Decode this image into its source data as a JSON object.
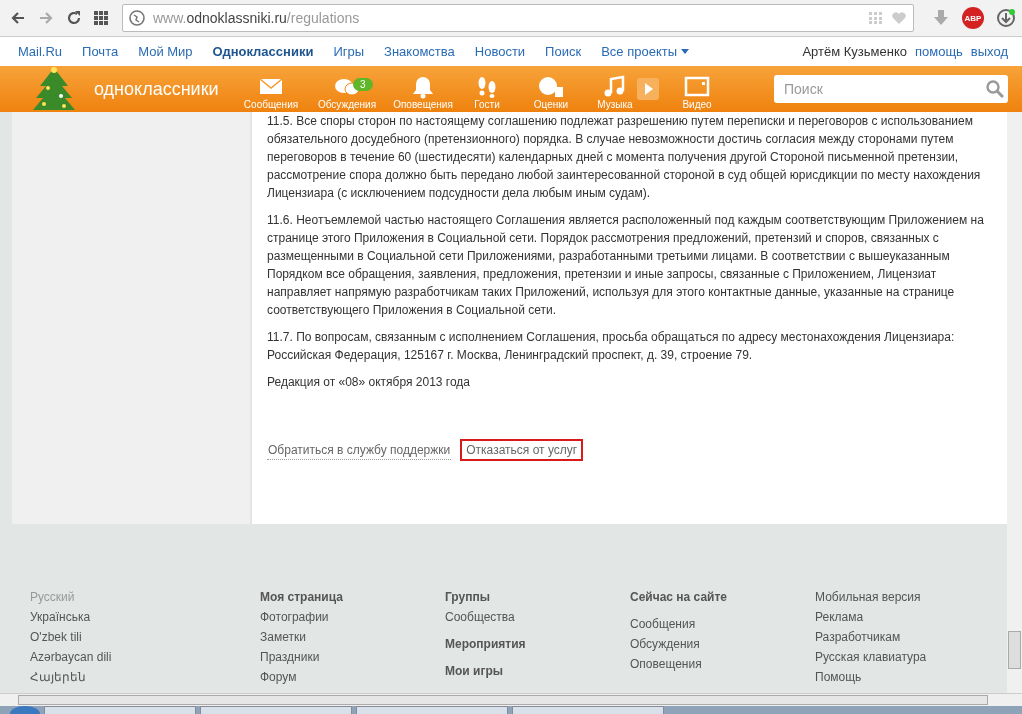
{
  "browser": {
    "url_host_prefix": "www.",
    "url_host": "odnoklassniki.ru",
    "url_path": "/regulations",
    "addon_label": "ABP"
  },
  "portal_bar": {
    "links": [
      {
        "label": "Mail.Ru",
        "selected": false
      },
      {
        "label": "Почта",
        "selected": false
      },
      {
        "label": "Мой Мир",
        "selected": false
      },
      {
        "label": "Одноклассники",
        "selected": true
      },
      {
        "label": "Игры",
        "selected": false
      },
      {
        "label": "Знакомства",
        "selected": false
      },
      {
        "label": "Новости",
        "selected": false
      },
      {
        "label": "Поиск",
        "selected": false
      },
      {
        "label": "Все проекты",
        "selected": false,
        "dropdown": true
      }
    ],
    "user": "Артём Кузьменко",
    "help": "помощь",
    "logout": "выход"
  },
  "header": {
    "logo": "одноклассники",
    "nav": [
      {
        "label": "Сообщения",
        "kind": "envelope"
      },
      {
        "label": "Обсуждения",
        "kind": "chat",
        "badge": "3"
      },
      {
        "label": "Оповещения",
        "kind": "bell"
      },
      {
        "label": "Гости",
        "kind": "feet"
      },
      {
        "label": "Оценки",
        "kind": "rating"
      },
      {
        "label": "Музыка",
        "kind": "note"
      },
      {
        "label": "Видео",
        "kind": "video"
      }
    ],
    "search": {
      "placeholder": "Поиск"
    }
  },
  "content": {
    "paragraphs": [
      "11.5. Все споры сторон по настоящему соглашению подлежат разрешению путем переписки и переговоров с использованием обязательного досудебного (претензионного) порядка. В случае невозможности достичь согласия между сторонами путем переговоров в течение 60 (шестидесяти) календарных дней с момента получения другой Стороной письменной претензии, рассмотрение спора должно быть передано любой заинтересованной стороной в суд общей юрисдикции по месту нахождения Лицензиара (с исключением подсудности дела любым иным судам).",
      "11.6. Неотъемлемой частью настоящего Соглашения является расположенный под каждым соответствующим Приложением на странице этого Приложения в Социальной сети. Порядок рассмотрения предложений, претензий и споров, связанных с размещенными в Социальной сети Приложениями, разработанными третьими лицами. В соответствии с вышеуказанным Порядком все обращения, заявления, предложения, претензии и иные запросы, связанные с Приложением, Лицензиат направляет напрямую разработчикам таких Приложений, используя для этого контактные данные, указанные на странице соответствующего Приложения в Социальной сети.",
      "11.7. По вопросам, связанным с исполнением Соглашения, просьба обращаться по адресу местонахождения Лицензиара: Российская Федерация, 125167 г. Москва, Ленинградский проспект, д. 39, строение 79.",
      "Редакция от «08» октября 2013 года"
    ],
    "links": [
      {
        "label": "Обратиться в службу поддержки",
        "highlighted": false
      },
      {
        "label": "Отказаться от услуг",
        "highlighted": true
      }
    ]
  },
  "footer": {
    "columns": [
      [
        {
          "label": "Русский",
          "kind": "current"
        },
        {
          "label": "Українська",
          "kind": "link"
        },
        {
          "label": "O'zbek tili",
          "kind": "link"
        },
        {
          "label": "Azərbaycan dili",
          "kind": "link"
        },
        {
          "label": "Հայերեն",
          "kind": "link"
        }
      ],
      [
        {
          "label": "Моя страница",
          "kind": "heading"
        },
        {
          "label": "Фотографии",
          "kind": "link"
        },
        {
          "label": "Заметки",
          "kind": "link"
        },
        {
          "label": "Праздники",
          "kind": "link"
        },
        {
          "label": "Форум",
          "kind": "link"
        }
      ],
      [
        {
          "label": "Группы",
          "kind": "heading"
        },
        {
          "label": "Сообщества",
          "kind": "link"
        },
        {
          "label": "Мероприятия",
          "kind": "heading"
        },
        {
          "label": "Мои игры",
          "kind": "heading"
        }
      ],
      [
        {
          "label": "Сейчас на сайте",
          "kind": "heading"
        },
        {
          "label": "Сообщения",
          "kind": "link"
        },
        {
          "label": "Обсуждения",
          "kind": "link"
        },
        {
          "label": "Оповещения",
          "kind": "link"
        }
      ],
      [
        {
          "label": "Мобильная версия",
          "kind": "link"
        },
        {
          "label": "Реклама",
          "kind": "link"
        },
        {
          "label": "Разработчикам",
          "kind": "link"
        },
        {
          "label": "Русская клавиатура",
          "kind": "link"
        },
        {
          "label": "Помощь",
          "kind": "link"
        }
      ]
    ]
  }
}
